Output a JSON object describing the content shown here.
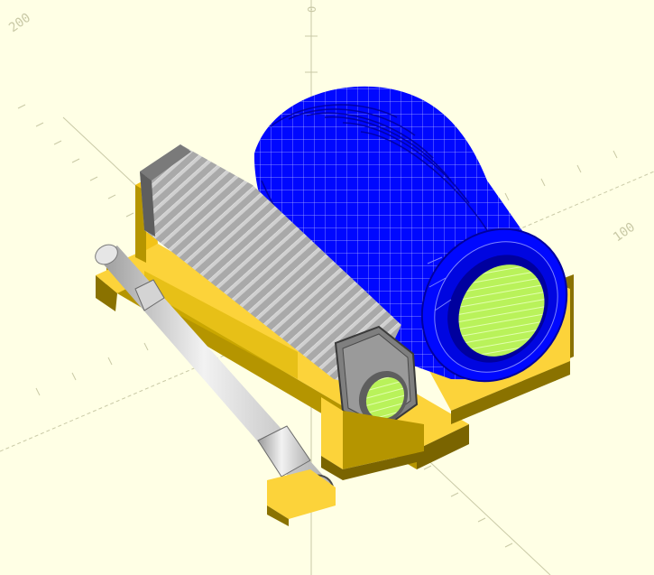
{
  "app": {
    "view": "3D preview",
    "background": "#ffffe5"
  },
  "axes": {
    "color": "#c8c8a8",
    "tick_labels": [
      {
        "id": "x-neg-200",
        "text": "200",
        "axis": "x"
      },
      {
        "id": "x-pos-100",
        "text": "100",
        "axis": "x"
      },
      {
        "id": "z-pos",
        "text": "0",
        "axis": "z"
      }
    ]
  },
  "model": {
    "colors": {
      "base_light": "#fcd33a",
      "base_mid": "#d9b400",
      "base_dark": "#8a7200",
      "roller_light": "#d4d4d4",
      "roller_dark": "#5e5e5e",
      "rod_light": "#f0f0f0",
      "coil_blue": "#0008ff",
      "coil_dark": "#00009e",
      "bore": "#b9f25a"
    },
    "parts": [
      "base-plate",
      "front-support",
      "back-support",
      "grey-roller",
      "blue-coil",
      "guide-rod"
    ]
  }
}
